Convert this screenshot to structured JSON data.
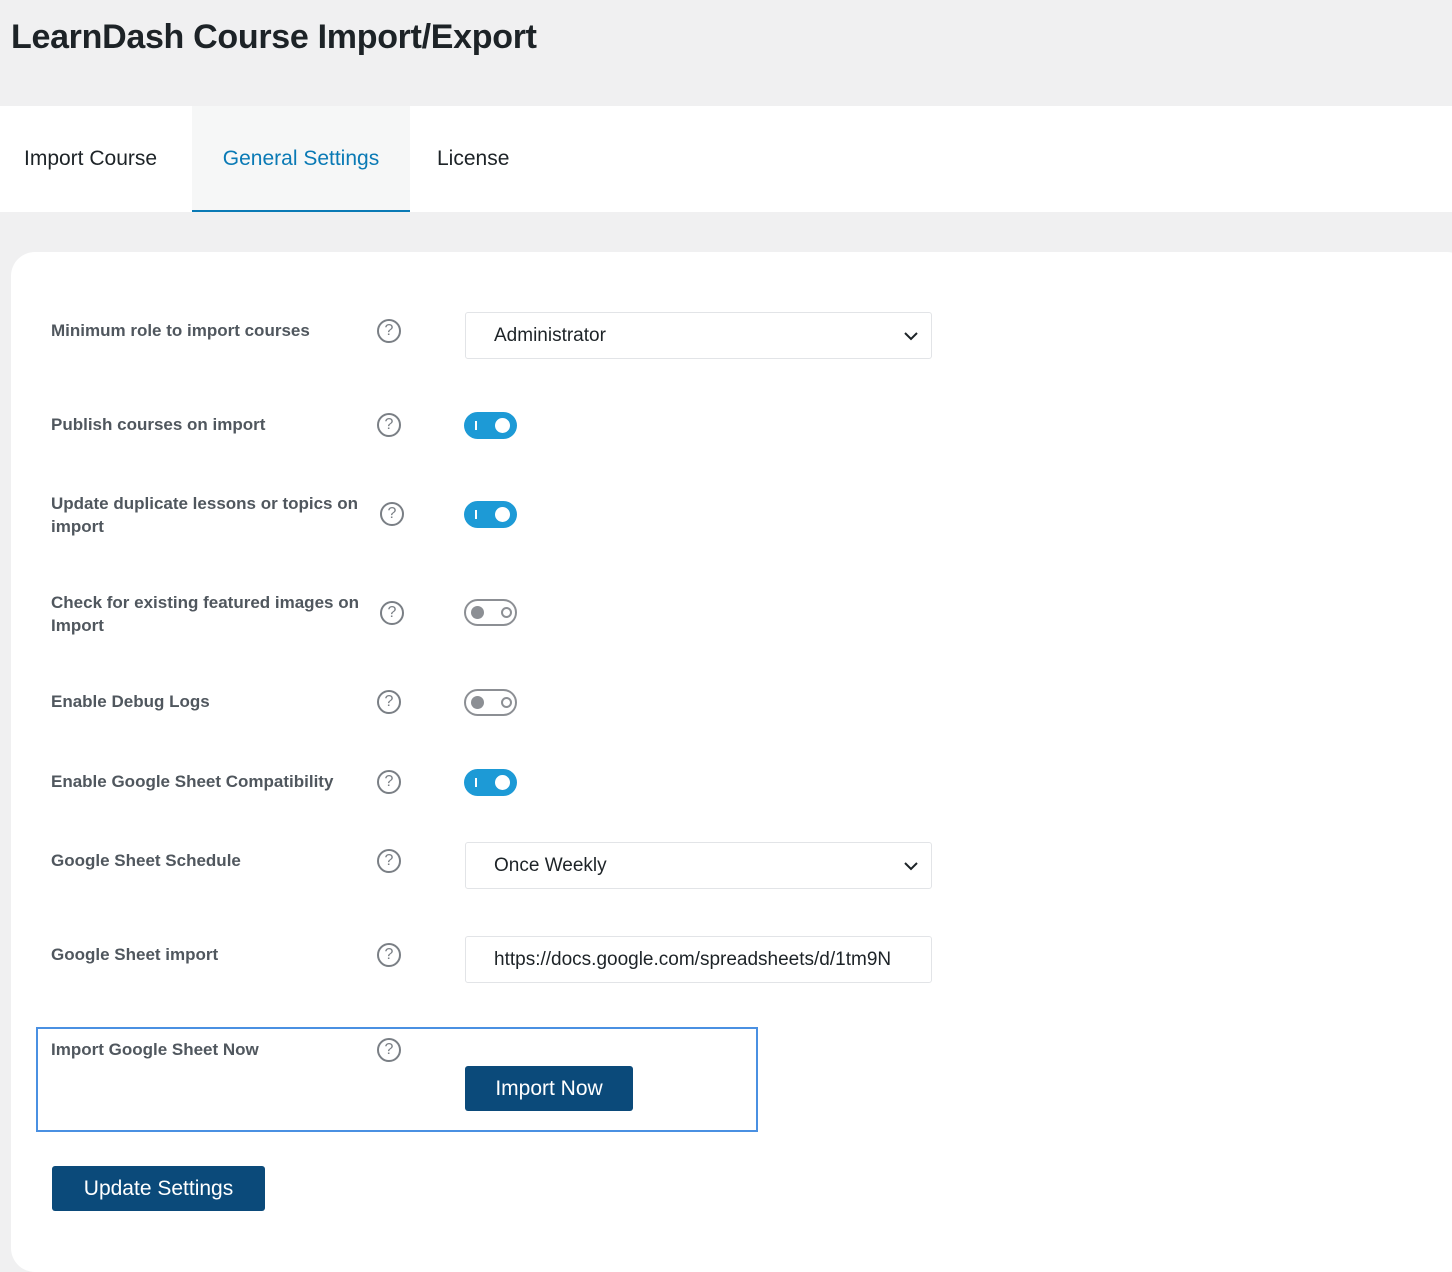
{
  "page": {
    "title": "LearnDash Course Import/Export"
  },
  "tabs": [
    {
      "label": "Import Course",
      "active": false
    },
    {
      "label": "General Settings",
      "active": true
    },
    {
      "label": "License",
      "active": false
    }
  ],
  "settings": {
    "min_role": {
      "label": "Minimum role to import courses",
      "value": "Administrator"
    },
    "publish": {
      "label": "Publish courses on import",
      "enabled": true
    },
    "update_duplicates": {
      "label": "Update duplicate lessons or topics on import",
      "enabled": true
    },
    "check_images": {
      "label": "Check for existing featured images on Import",
      "enabled": false
    },
    "debug_logs": {
      "label": "Enable Debug Logs",
      "enabled": false
    },
    "gsheet_compat": {
      "label": "Enable Google Sheet Compatibility",
      "enabled": true
    },
    "gsheet_schedule": {
      "label": "Google Sheet Schedule",
      "value": "Once Weekly"
    },
    "gsheet_import": {
      "label": "Google Sheet import",
      "value": "https://docs.google.com/spreadsheets/d/1tm9N"
    },
    "import_now": {
      "label": "Import Google Sheet Now",
      "button_label": "Import Now"
    }
  },
  "help_glyph": "?",
  "icons": {
    "help": "question-circle-icon",
    "dropdown": "chevron-down-icon"
  },
  "buttons": {
    "update_settings": "Update Settings"
  },
  "colors": {
    "accent": "#1d9ad6",
    "tab_active": "#0a7ab5",
    "primary_button": "#0b4a7a",
    "highlight_border": "#4a90e2"
  }
}
